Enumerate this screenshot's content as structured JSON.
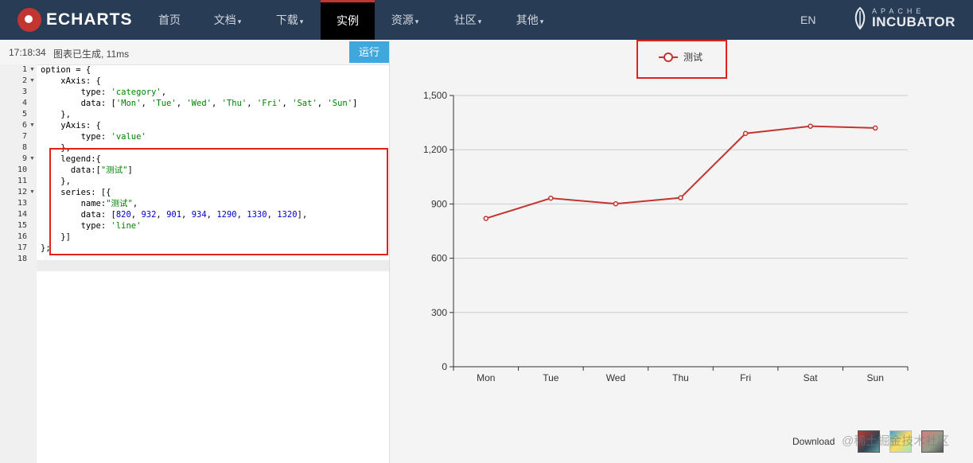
{
  "nav": {
    "logo": "ECHARTS",
    "items": [
      {
        "label": "首页",
        "caret": ""
      },
      {
        "label": "文档",
        "caret": "▾"
      },
      {
        "label": "下载",
        "caret": "▾"
      },
      {
        "label": "实例",
        "caret": ""
      },
      {
        "label": "资源",
        "caret": "▾"
      },
      {
        "label": "社区",
        "caret": "▾"
      },
      {
        "label": "其他",
        "caret": "▾"
      }
    ],
    "lang": "EN",
    "incubator_top": "APACHE",
    "incubator_main": "INCUBATOR"
  },
  "editor": {
    "status_time": "17:18:34",
    "status_msg": "图表已生成, 11ms",
    "run_label": "运行",
    "line_numbers": [
      "1",
      "2",
      "3",
      "4",
      "5",
      "6",
      "7",
      "8",
      "9",
      "10",
      "11",
      "12",
      "13",
      "14",
      "15",
      "16",
      "17",
      "18"
    ],
    "fold_lines": [
      "1",
      "2",
      "6",
      "9",
      "12"
    ]
  },
  "chart": {
    "accent": "#c23531",
    "legend_label": "测试",
    "download_label": "Download",
    "watermark": "@稀土掘金技术社区"
  },
  "chart_data": {
    "type": "line",
    "categories": [
      "Mon",
      "Tue",
      "Wed",
      "Thu",
      "Fri",
      "Sat",
      "Sun"
    ],
    "series": [
      {
        "name": "测试",
        "values": [
          820,
          932,
          901,
          934,
          1290,
          1330,
          1320
        ]
      }
    ],
    "yticks": [
      "0",
      "300",
      "600",
      "900",
      "1,200",
      "1,500"
    ],
    "ylim": [
      0,
      1500
    ],
    "grid": true,
    "legend": "top-center"
  }
}
